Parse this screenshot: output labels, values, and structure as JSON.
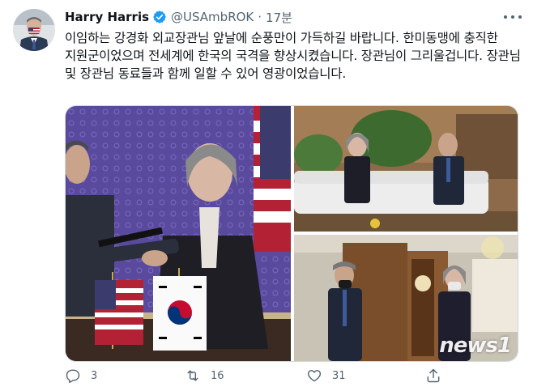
{
  "tweet": {
    "author_name": "Harry Harris",
    "handle": "@USAmbROK",
    "separator": "·",
    "timestamp": "17분",
    "text": "이임하는 강경화 외교장관님 앞날에 순풍만이 가득하길 바랍니다. 한미동맹에 충직한 지원군이었으며 전세계에 한국의 국격을 향상시켰습니다. 장관님이 그리울겁니다. 장관님 및 장관님 동료들과 함께 일할 수 있어 영광이었습니다."
  },
  "actions": {
    "reply_count": "3",
    "retweet_count": "16",
    "like_count": "31"
  },
  "watermark": {
    "text": "news1"
  },
  "colors": {
    "verified": "#1d9bf0",
    "secondary_text": "#536471",
    "primary_text": "#0f1419"
  },
  "icons": [
    "verified-badge-icon",
    "more-options-icon",
    "reply-icon",
    "retweet-icon",
    "like-icon",
    "share-icon"
  ]
}
